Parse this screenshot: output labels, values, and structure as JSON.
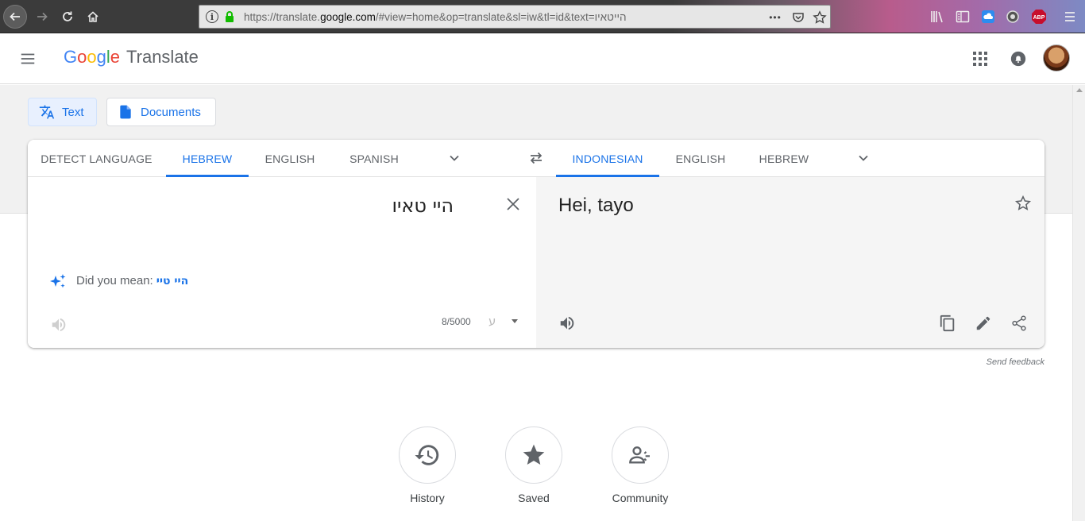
{
  "browser": {
    "url_prefix": "https://translate.",
    "url_domain": "google.com",
    "url_suffix": "/#view=home&op=translate&sl=iw&tl=id&text=הייטאיו",
    "url_info_glyph": "i",
    "url_more_glyph": "•••",
    "abp_label": "ABP"
  },
  "header": {
    "logo_letters": [
      "G",
      "o",
      "o",
      "g",
      "l",
      "e"
    ],
    "product_name": "Translate"
  },
  "modes": {
    "text_label": "Text",
    "documents_label": "Documents"
  },
  "source_langs": [
    {
      "label": "DETECT LANGUAGE",
      "active": false
    },
    {
      "label": "HEBREW",
      "active": true
    },
    {
      "label": "ENGLISH",
      "active": false
    },
    {
      "label": "SPANISH",
      "active": false
    }
  ],
  "target_langs": [
    {
      "label": "INDONESIAN",
      "active": true
    },
    {
      "label": "ENGLISH",
      "active": false
    },
    {
      "label": "HEBREW",
      "active": false
    }
  ],
  "source": {
    "text": "היי טאיו",
    "did_you_mean_label": "Did you mean:",
    "did_you_mean_suggestion": "היי טיי",
    "char_count": "8/5000",
    "input_tool_glyph": "ע"
  },
  "target": {
    "text": "Hei, tayo"
  },
  "send_feedback": "Send feedback",
  "bottom_actions": [
    {
      "label": "History",
      "icon": "history-icon"
    },
    {
      "label": "Saved",
      "icon": "star-icon"
    },
    {
      "label": "Community",
      "icon": "community-icon"
    }
  ],
  "colors": {
    "accent": "#1a73e8",
    "accent_bg": "#e8f0fe",
    "page_band": "#f1f1f1",
    "target_pane": "#f5f5f5"
  }
}
